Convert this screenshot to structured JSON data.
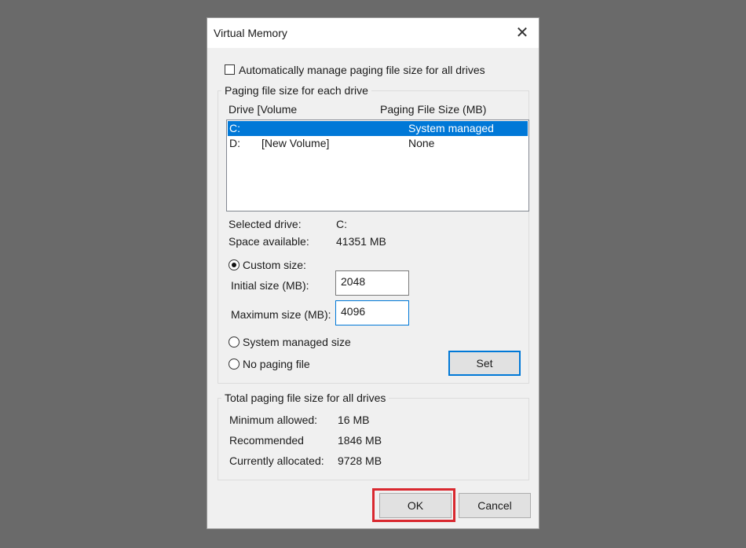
{
  "dialog": {
    "title": "Virtual Memory",
    "close_glyph": "✕",
    "auto_manage_label": "Automatically manage paging file size for all drives",
    "auto_manage_checked": false
  },
  "drive_group": {
    "label": "Paging file size for each drive",
    "col_drive": "Drive  [Volume",
    "col_size": "Paging File Size (MB)",
    "rows": [
      {
        "drive": "C:",
        "volume": "",
        "size": "System managed",
        "selected": true
      },
      {
        "drive": "D:",
        "volume": "[New Volume]",
        "size": "None",
        "selected": false
      }
    ],
    "selected_drive_label": "Selected drive:",
    "selected_drive_value": "C:",
    "space_label": "Space available:",
    "space_value": "41351 MB",
    "custom_size_label": "Custom size:",
    "initial_label": "Initial size (MB):",
    "initial_value": "2048",
    "max_label": "Maximum size (MB):",
    "max_value": "4096",
    "system_managed_label": "System managed size",
    "no_paging_label": "No paging file",
    "set_label": "Set",
    "selected_option": "Custom size"
  },
  "total_group": {
    "label": "Total paging file size for all drives",
    "min_label": "Minimum allowed:",
    "min_value": "16 MB",
    "rec_label": "Recommended",
    "rec_value": "1846 MB",
    "cur_label": "Currently allocated:",
    "cur_value": "9728 MB"
  },
  "buttons": {
    "ok": "OK",
    "cancel": "Cancel"
  },
  "colors": {
    "selection": "#0078d7",
    "highlight": "#d9282f"
  }
}
